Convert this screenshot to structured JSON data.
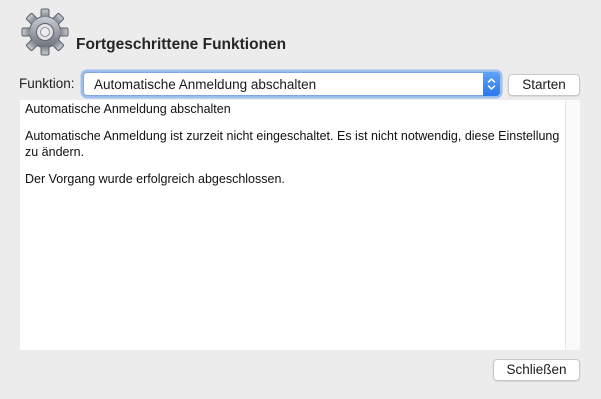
{
  "header": {
    "title": "Fortgeschrittene Funktionen",
    "icon": "gear-icon"
  },
  "function": {
    "label": "Funktion:",
    "selected": "Automatische Anmeldung abschalten"
  },
  "buttons": {
    "start": "Starten",
    "close": "Schließen"
  },
  "output": {
    "lines": [
      "Automatische Anmeldung abschalten",
      "Automatische Anmeldung ist zurzeit nicht eingeschaltet. Es ist nicht notwendig, diese Einstellung zu ändern.",
      "Der Vorgang wurde erfolgreich abgeschlossen."
    ]
  },
  "colors": {
    "accent": "#2a78e8",
    "window_bg": "#ececec"
  }
}
